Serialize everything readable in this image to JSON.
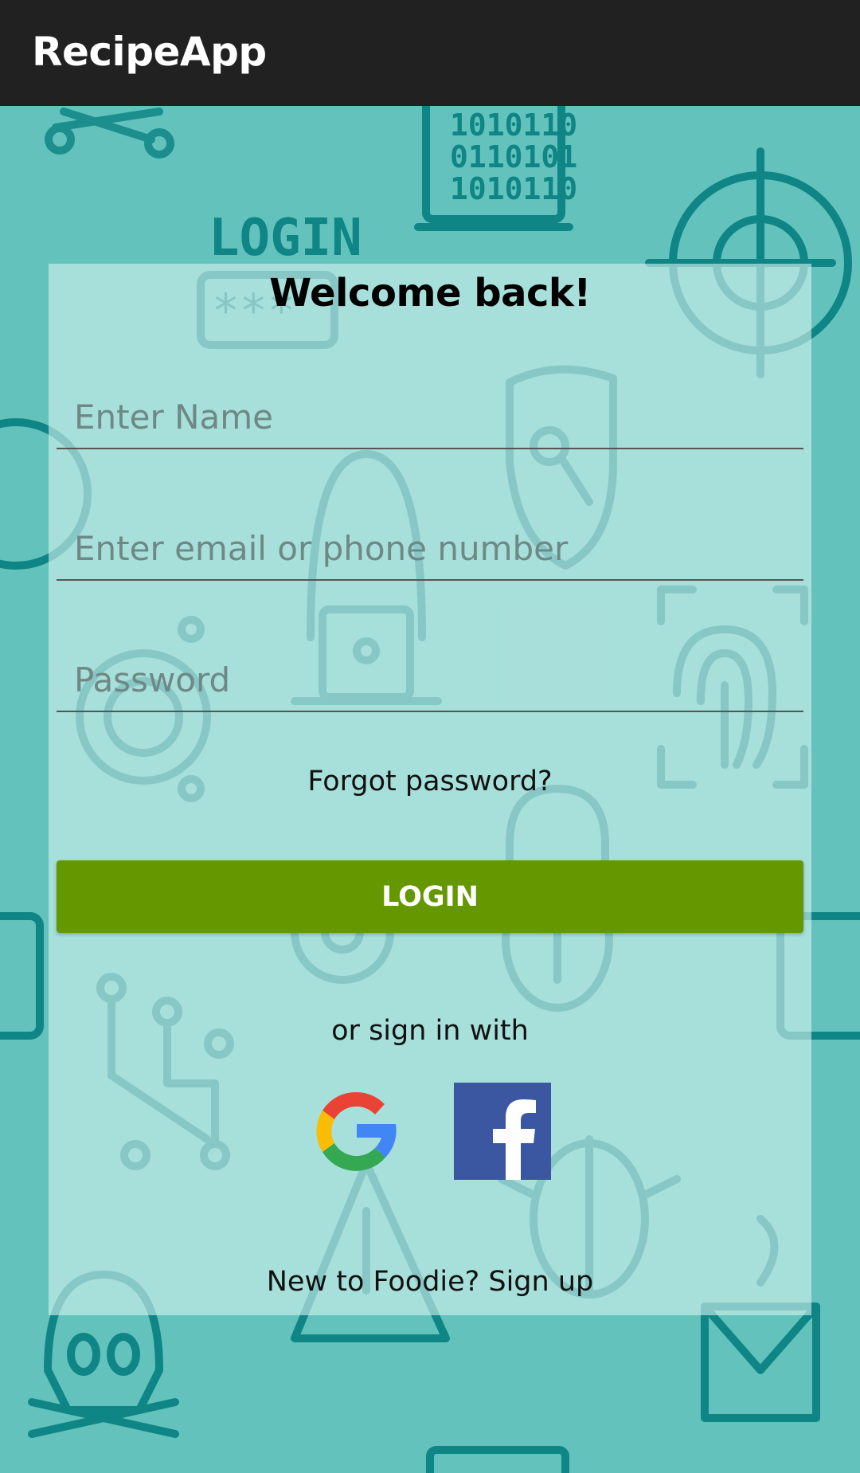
{
  "app_bar": {
    "title": "RecipeApp"
  },
  "background": {
    "login_sign_text": "LOGIN",
    "binary_lines": [
      "1010110",
      "0110101",
      "1010110"
    ],
    "password_mask": "***"
  },
  "form": {
    "heading": "Welcome back!",
    "name_placeholder": "Enter Name",
    "email_placeholder": "Enter email or phone number",
    "password_placeholder": "Password",
    "forgot_password": "Forgot password?",
    "login_button": "LOGIN",
    "or_sign_in": "or sign in with",
    "signup_text": "New to Foodie? Sign up"
  },
  "social": [
    {
      "icon": "google-icon"
    },
    {
      "icon": "facebook-icon"
    }
  ],
  "colors": {
    "app_bar": "#212121",
    "background": "#63c3bc",
    "card_overlay": "#d2f0ee",
    "login_button": "#659700",
    "facebook_blue": "#3b57a1"
  }
}
